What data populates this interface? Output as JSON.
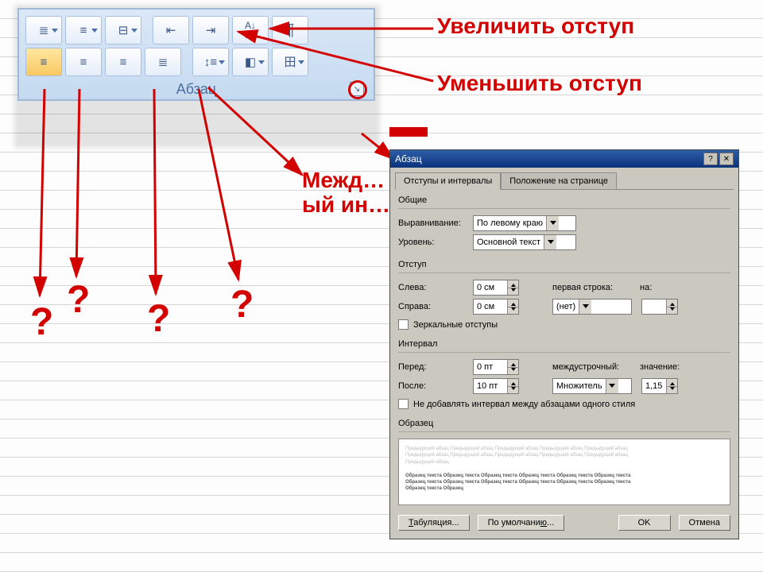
{
  "ribbon": {
    "group_label": "Абзац",
    "row1": [
      "bullets",
      "numbering",
      "multilevel",
      "decrease-indent",
      "increase-indent",
      "sort",
      "pilcrow"
    ],
    "row2": [
      "align-left",
      "align-center",
      "align-right",
      "justify",
      "line-spacing",
      "shading",
      "borders"
    ]
  },
  "callouts": {
    "increase": "Увеличить отступ",
    "decrease": "Уменьшить отступ",
    "middle": "Межд…\nый ин…",
    "q1": "?",
    "q2": "?",
    "q3": "?",
    "q4": "?"
  },
  "dialog": {
    "title": "Абзац",
    "tabs": {
      "active": "Отступы и интервалы",
      "inactive": "Положение на странице"
    },
    "group_general": "Общие",
    "alignment_label": "Выравнивание:",
    "alignment_value": "По левому краю",
    "level_label": "Уровень:",
    "level_value": "Основной текст",
    "group_indent": "Отступ",
    "left_label": "Слева:",
    "left_value": "0 см",
    "right_label": "Справа:",
    "right_value": "0 см",
    "firstline_label": "первая строка:",
    "firstline_value": "(нет)",
    "by_label": "на:",
    "by_value": "",
    "mirror": "Зеркальные отступы",
    "group_spacing": "Интервал",
    "before_label": "Перед:",
    "before_value": "0 пт",
    "after_label": "После:",
    "after_value": "10 пт",
    "linespacing_label": "междустрочный:",
    "linespacing_value": "Множитель",
    "at_label": "значение:",
    "at_value": "1,15",
    "dontadd": "Не добавлять интервал между абзацами одного стиля",
    "group_preview": "Образец",
    "btn_tabs": "Табуляция...",
    "btn_default": "По умолчанию...",
    "btn_ok": "OK",
    "btn_cancel": "Отмена"
  }
}
